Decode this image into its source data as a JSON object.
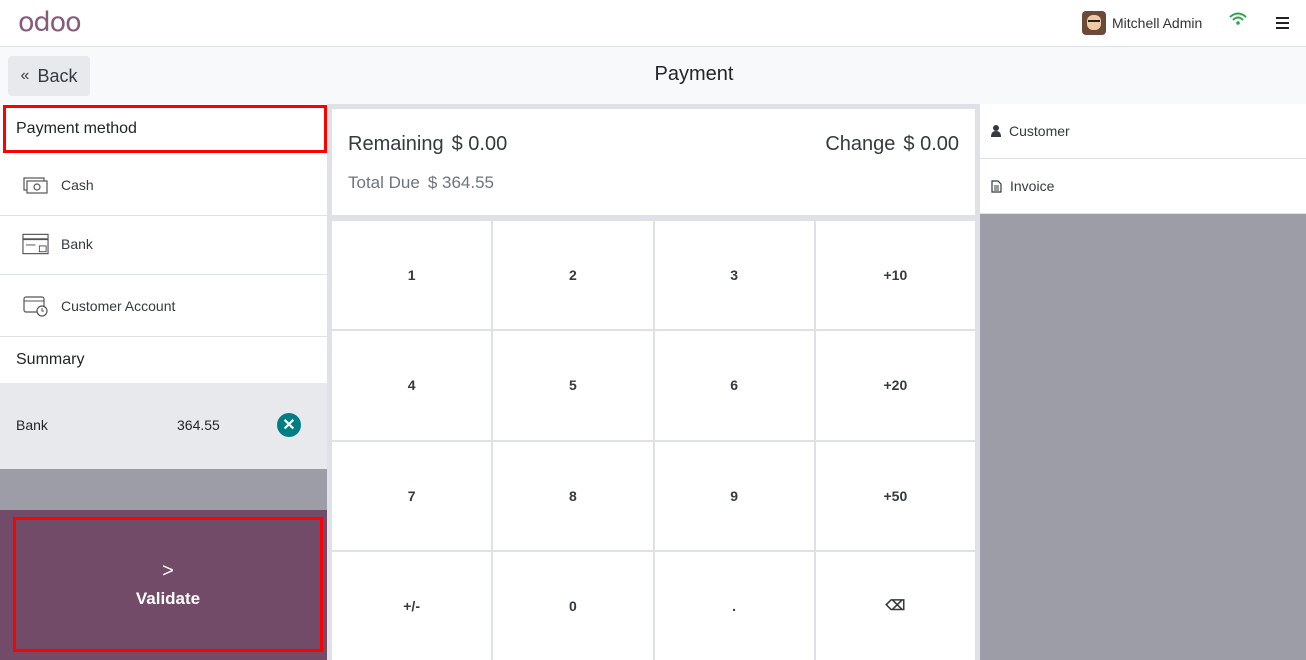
{
  "brand": {
    "logo_main": "odoo"
  },
  "user": {
    "name": "Mitchell Admin"
  },
  "header": {
    "back_label": "Back",
    "title": "Payment"
  },
  "payment_methods": {
    "heading": "Payment method",
    "items": [
      {
        "label": "Cash",
        "icon": "cash-icon"
      },
      {
        "label": "Bank",
        "icon": "bank-card-icon"
      },
      {
        "label": "Customer Account",
        "icon": "customer-account-icon"
      }
    ]
  },
  "summary": {
    "heading": "Summary",
    "lines": [
      {
        "method": "Bank",
        "amount": "364.55"
      }
    ]
  },
  "validate": {
    "label": "Validate"
  },
  "status": {
    "remaining_label": "Remaining",
    "remaining_value": "$ 0.00",
    "change_label": "Change",
    "change_value": "$ 0.00",
    "total_due_label": "Total Due",
    "total_due_value": "$ 364.55"
  },
  "numpad": {
    "keys": [
      "1",
      "2",
      "3",
      "+10",
      "4",
      "5",
      "6",
      "+20",
      "7",
      "8",
      "9",
      "+50",
      "+/-",
      "0",
      ".",
      "⌫"
    ]
  },
  "right_panel": {
    "customer_label": "Customer",
    "invoice_label": "Invoice"
  },
  "colors": {
    "brand": "#714b67",
    "highlight": "#ff0000",
    "delete_button": "#017e84",
    "panel_gray": "#9c9da6",
    "wifi": "#28a745"
  }
}
